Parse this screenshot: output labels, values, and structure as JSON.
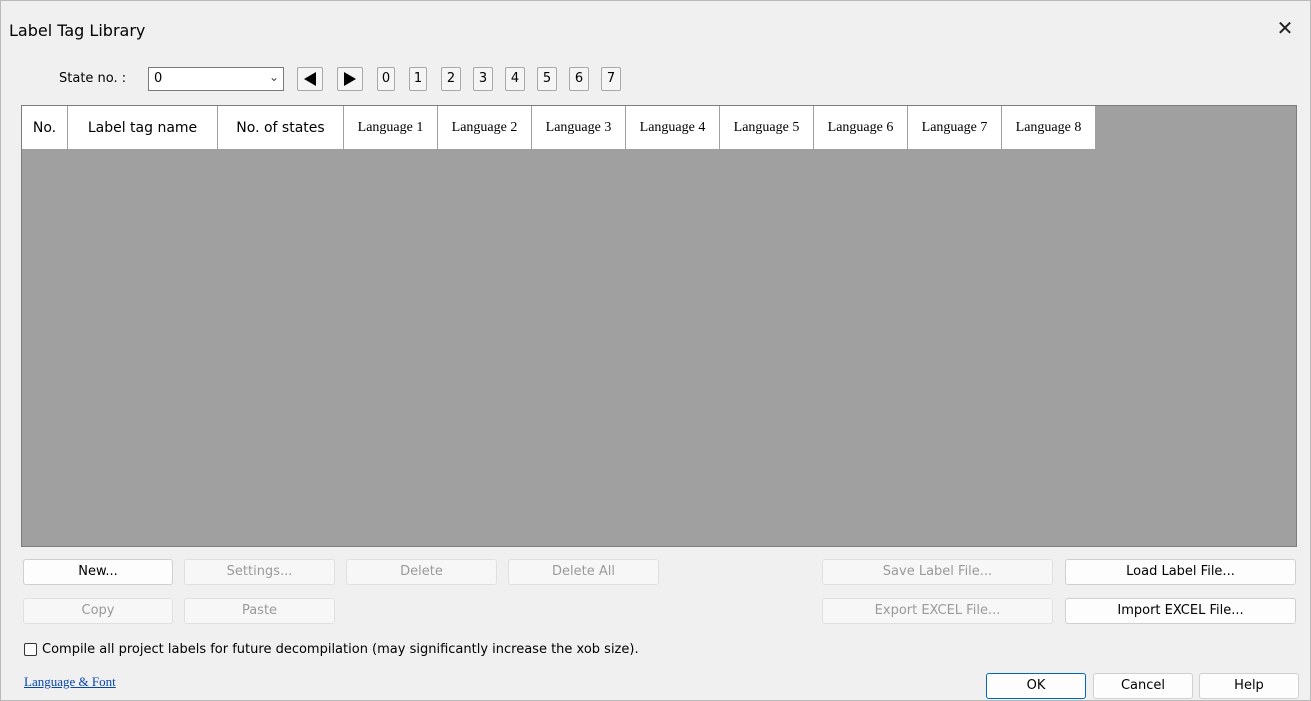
{
  "window": {
    "title": "Label Tag Library",
    "close_glyph": "✕"
  },
  "state": {
    "label": "State no. :",
    "selected": "0",
    "numbers": [
      "0",
      "1",
      "2",
      "3",
      "4",
      "5",
      "6",
      "7"
    ]
  },
  "table": {
    "headers": [
      "No.",
      "Label tag name",
      "No. of states",
      "Language 1",
      "Language 2",
      "Language 3",
      "Language 4",
      "Language 5",
      "Language 6",
      "Language 7",
      "Language 8"
    ],
    "rows": []
  },
  "buttons": {
    "new": "New...",
    "settings": "Settings...",
    "delete": "Delete",
    "delete_all": "Delete All",
    "save_label_file": "Save Label File...",
    "load_label_file": "Load Label File...",
    "copy": "Copy",
    "paste": "Paste",
    "export_excel": "Export EXCEL File...",
    "import_excel": "Import EXCEL File...",
    "ok": "OK",
    "cancel": "Cancel",
    "help": "Help"
  },
  "compile_checkbox": {
    "label": "Compile all project labels for future decompilation (may significantly increase the xob size).",
    "checked": false
  },
  "link": "Language & Font",
  "colors": {
    "grid_bg": "#a0a0a0",
    "dialog_bg": "#f0f0f0",
    "accent": "#0067c0",
    "link": "#0645ad"
  }
}
